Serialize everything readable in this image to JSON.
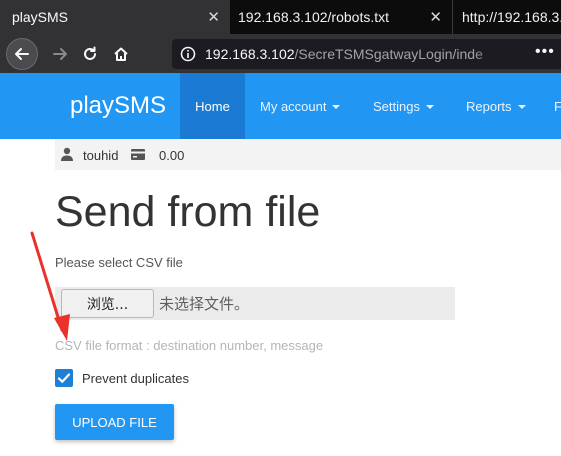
{
  "browser": {
    "tabs": [
      {
        "title": "playSMS",
        "active": true
      },
      {
        "title": "192.168.3.102/robots.txt",
        "active": false
      },
      {
        "title": "http://192.168.3.",
        "active": false
      }
    ],
    "url": {
      "host": "192.168.3.102",
      "path": "/SecreTSMSgatwayLogin/inde"
    },
    "close_glyph": "✕",
    "more_glyph": "•••"
  },
  "site": {
    "brand": "playSMS",
    "menu": {
      "home": "Home",
      "my_account": "My account",
      "settings": "Settings",
      "reports": "Reports",
      "cut": "F"
    },
    "colors": {
      "accent": "#2196f3",
      "active_menu": "#1a7ad4"
    }
  },
  "userbar": {
    "username": "touhid",
    "credit": "0.00"
  },
  "main": {
    "title": "Send from file",
    "select_label": "Please select CSV file",
    "file_button": "浏览...",
    "file_status": "未选择文件。",
    "csv_hint": "CSV file format : destination number, message",
    "prevent_duplicates": "Prevent duplicates",
    "prevent_duplicates_checked": true,
    "upload_button": "UPLOAD FILE"
  },
  "annotation": {
    "arrow_color": "#e8322b"
  }
}
